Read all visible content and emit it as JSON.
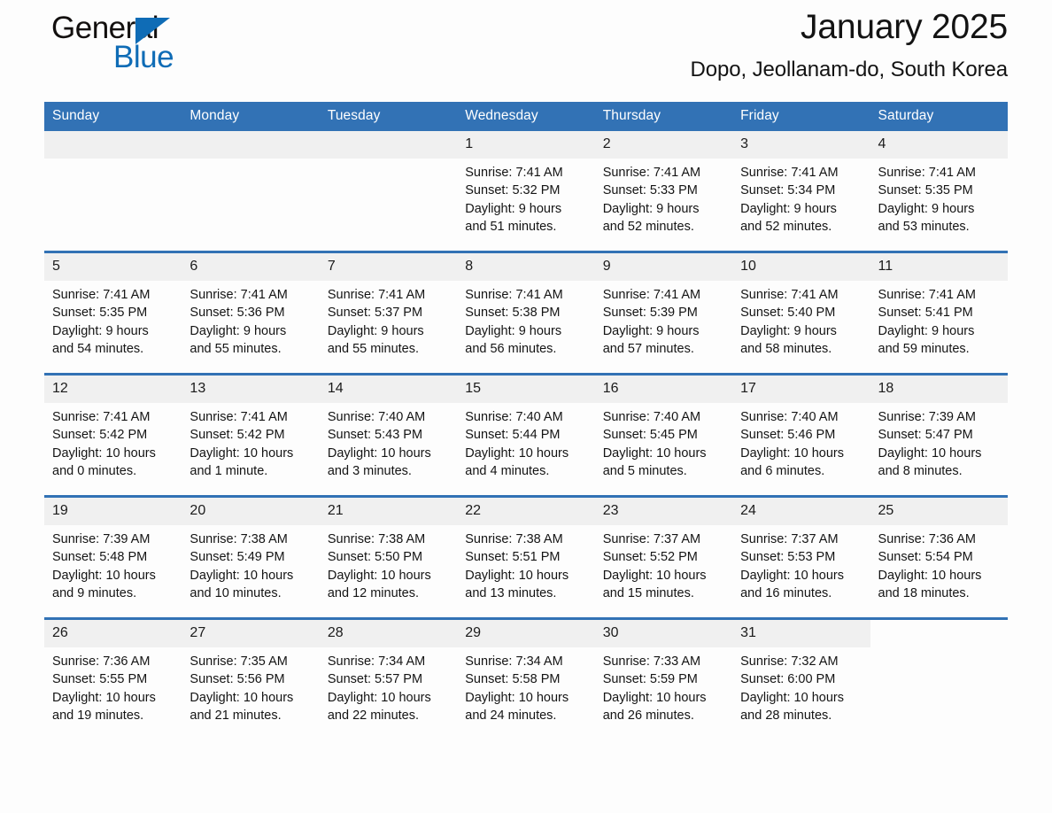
{
  "brand": {
    "name_top": "General",
    "name_bottom": "Blue",
    "triangle_color": "#0f6cb6"
  },
  "header": {
    "title": "January 2025",
    "subtitle": "Dopo, Jeollanam-do, South Korea"
  },
  "theme": {
    "header_blue": "#3272b5",
    "row_divider_blue": "#3272b5",
    "daynum_band": "#f0f0f0",
    "page_background": "#fdfdfd"
  },
  "calendar": {
    "weekday_headers": [
      "Sunday",
      "Monday",
      "Tuesday",
      "Wednesday",
      "Thursday",
      "Friday",
      "Saturday"
    ],
    "weeks": [
      [
        {
          "day": "",
          "info": "",
          "blank": true
        },
        {
          "day": "",
          "info": "",
          "blank": true
        },
        {
          "day": "",
          "info": "",
          "blank": true
        },
        {
          "day": "1",
          "info": "Sunrise: 7:41 AM\nSunset: 5:32 PM\nDaylight: 9 hours\nand 51 minutes."
        },
        {
          "day": "2",
          "info": "Sunrise: 7:41 AM\nSunset: 5:33 PM\nDaylight: 9 hours\nand 52 minutes."
        },
        {
          "day": "3",
          "info": "Sunrise: 7:41 AM\nSunset: 5:34 PM\nDaylight: 9 hours\nand 52 minutes."
        },
        {
          "day": "4",
          "info": "Sunrise: 7:41 AM\nSunset: 5:35 PM\nDaylight: 9 hours\nand 53 minutes."
        }
      ],
      [
        {
          "day": "5",
          "info": "Sunrise: 7:41 AM\nSunset: 5:35 PM\nDaylight: 9 hours\nand 54 minutes."
        },
        {
          "day": "6",
          "info": "Sunrise: 7:41 AM\nSunset: 5:36 PM\nDaylight: 9 hours\nand 55 minutes."
        },
        {
          "day": "7",
          "info": "Sunrise: 7:41 AM\nSunset: 5:37 PM\nDaylight: 9 hours\nand 55 minutes."
        },
        {
          "day": "8",
          "info": "Sunrise: 7:41 AM\nSunset: 5:38 PM\nDaylight: 9 hours\nand 56 minutes."
        },
        {
          "day": "9",
          "info": "Sunrise: 7:41 AM\nSunset: 5:39 PM\nDaylight: 9 hours\nand 57 minutes."
        },
        {
          "day": "10",
          "info": "Sunrise: 7:41 AM\nSunset: 5:40 PM\nDaylight: 9 hours\nand 58 minutes."
        },
        {
          "day": "11",
          "info": "Sunrise: 7:41 AM\nSunset: 5:41 PM\nDaylight: 9 hours\nand 59 minutes."
        }
      ],
      [
        {
          "day": "12",
          "info": "Sunrise: 7:41 AM\nSunset: 5:42 PM\nDaylight: 10 hours\nand 0 minutes."
        },
        {
          "day": "13",
          "info": "Sunrise: 7:41 AM\nSunset: 5:42 PM\nDaylight: 10 hours\nand 1 minute."
        },
        {
          "day": "14",
          "info": "Sunrise: 7:40 AM\nSunset: 5:43 PM\nDaylight: 10 hours\nand 3 minutes."
        },
        {
          "day": "15",
          "info": "Sunrise: 7:40 AM\nSunset: 5:44 PM\nDaylight: 10 hours\nand 4 minutes."
        },
        {
          "day": "16",
          "info": "Sunrise: 7:40 AM\nSunset: 5:45 PM\nDaylight: 10 hours\nand 5 minutes."
        },
        {
          "day": "17",
          "info": "Sunrise: 7:40 AM\nSunset: 5:46 PM\nDaylight: 10 hours\nand 6 minutes."
        },
        {
          "day": "18",
          "info": "Sunrise: 7:39 AM\nSunset: 5:47 PM\nDaylight: 10 hours\nand 8 minutes."
        }
      ],
      [
        {
          "day": "19",
          "info": "Sunrise: 7:39 AM\nSunset: 5:48 PM\nDaylight: 10 hours\nand 9 minutes."
        },
        {
          "day": "20",
          "info": "Sunrise: 7:38 AM\nSunset: 5:49 PM\nDaylight: 10 hours\nand 10 minutes."
        },
        {
          "day": "21",
          "info": "Sunrise: 7:38 AM\nSunset: 5:50 PM\nDaylight: 10 hours\nand 12 minutes."
        },
        {
          "day": "22",
          "info": "Sunrise: 7:38 AM\nSunset: 5:51 PM\nDaylight: 10 hours\nand 13 minutes."
        },
        {
          "day": "23",
          "info": "Sunrise: 7:37 AM\nSunset: 5:52 PM\nDaylight: 10 hours\nand 15 minutes."
        },
        {
          "day": "24",
          "info": "Sunrise: 7:37 AM\nSunset: 5:53 PM\nDaylight: 10 hours\nand 16 minutes."
        },
        {
          "day": "25",
          "info": "Sunrise: 7:36 AM\nSunset: 5:54 PM\nDaylight: 10 hours\nand 18 minutes."
        }
      ],
      [
        {
          "day": "26",
          "info": "Sunrise: 7:36 AM\nSunset: 5:55 PM\nDaylight: 10 hours\nand 19 minutes."
        },
        {
          "day": "27",
          "info": "Sunrise: 7:35 AM\nSunset: 5:56 PM\nDaylight: 10 hours\nand 21 minutes."
        },
        {
          "day": "28",
          "info": "Sunrise: 7:34 AM\nSunset: 5:57 PM\nDaylight: 10 hours\nand 22 minutes."
        },
        {
          "day": "29",
          "info": "Sunrise: 7:34 AM\nSunset: 5:58 PM\nDaylight: 10 hours\nand 24 minutes."
        },
        {
          "day": "30",
          "info": "Sunrise: 7:33 AM\nSunset: 5:59 PM\nDaylight: 10 hours\nand 26 minutes."
        },
        {
          "day": "31",
          "info": "Sunrise: 7:32 AM\nSunset: 6:00 PM\nDaylight: 10 hours\nand 28 minutes."
        },
        {
          "day": "",
          "info": "",
          "empty": true
        }
      ]
    ]
  }
}
